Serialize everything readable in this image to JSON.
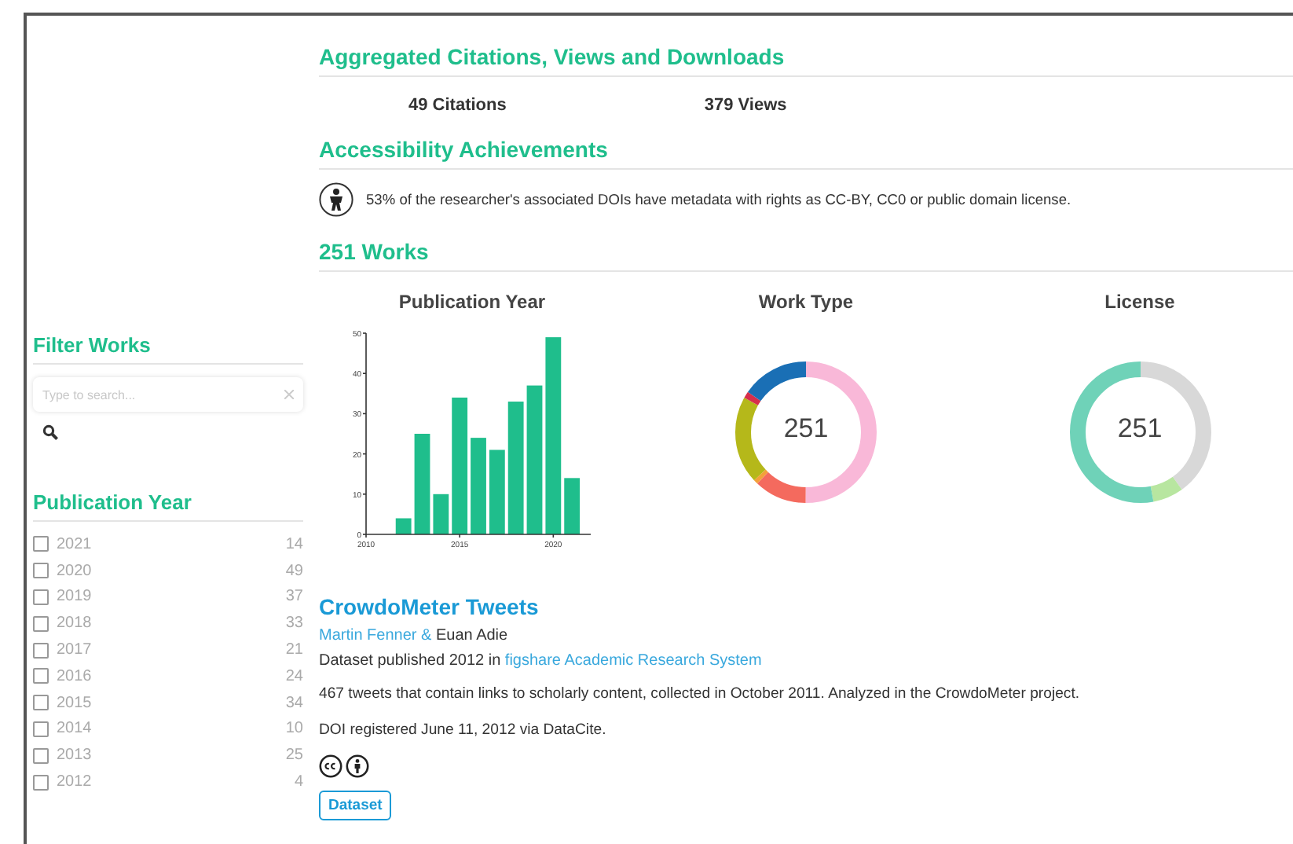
{
  "sidebar": {
    "filter_title": "Filter Works",
    "search": {
      "placeholder": "Type to search..."
    },
    "facet_title": "Publication Year",
    "facets": [
      {
        "label": "2021",
        "count": "14",
        "checked": false
      },
      {
        "label": "2020",
        "count": "49",
        "checked": false
      },
      {
        "label": "2019",
        "count": "37",
        "checked": false
      },
      {
        "label": "2018",
        "count": "33",
        "checked": false
      },
      {
        "label": "2017",
        "count": "21",
        "checked": false
      },
      {
        "label": "2016",
        "count": "24",
        "checked": false
      },
      {
        "label": "2015",
        "count": "34",
        "checked": false
      },
      {
        "label": "2014",
        "count": "10",
        "checked": false
      },
      {
        "label": "2013",
        "count": "25",
        "checked": false
      },
      {
        "label": "2012",
        "count": "4",
        "checked": false
      }
    ]
  },
  "aggregated": {
    "title": "Aggregated Citations, Views and Downloads",
    "stats": [
      "49 Citations",
      "379 Views"
    ]
  },
  "accessibility": {
    "title": "Accessibility Achievements",
    "text": "53% of the researcher's associated DOIs have metadata with rights as CC-BY, CC0 or public domain license."
  },
  "works": {
    "title": "251 Works",
    "charts": [
      {
        "kind": "bar",
        "chart_data": {
          "type": "bar",
          "title": "Publication Year",
          "x": [
            2012,
            2013,
            2014,
            2015,
            2016,
            2017,
            2018,
            2019,
            2020,
            2021
          ],
          "values": [
            4,
            25,
            10,
            34,
            24,
            21,
            33,
            37,
            49,
            14
          ],
          "xlim": [
            2010,
            2022
          ],
          "ylim": [
            0,
            50
          ],
          "xticks": [
            2010,
            2015,
            2020
          ],
          "yticks": [
            0,
            10,
            20,
            30,
            40,
            50
          ]
        }
      },
      {
        "kind": "donut",
        "title": "Work Type",
        "center": "251"
      },
      {
        "kind": "donut",
        "title": "License",
        "center": "251"
      }
    ]
  },
  "work": {
    "title": "CrowdoMeter Tweets",
    "authors": [
      {
        "name": "Martin Fenner &",
        "link": true
      },
      {
        "name": "Euan Adie",
        "link": false
      }
    ],
    "published": "Dataset published 2012 in",
    "publisher": "figshare Academic Research System",
    "description": "467 tweets that contain links to scholarly content, collected in October 2011. Analyzed in the CrowdoMeter project.",
    "registered": "DOI registered June 11, 2012 via DataCite.",
    "tag": "Dataset"
  }
}
